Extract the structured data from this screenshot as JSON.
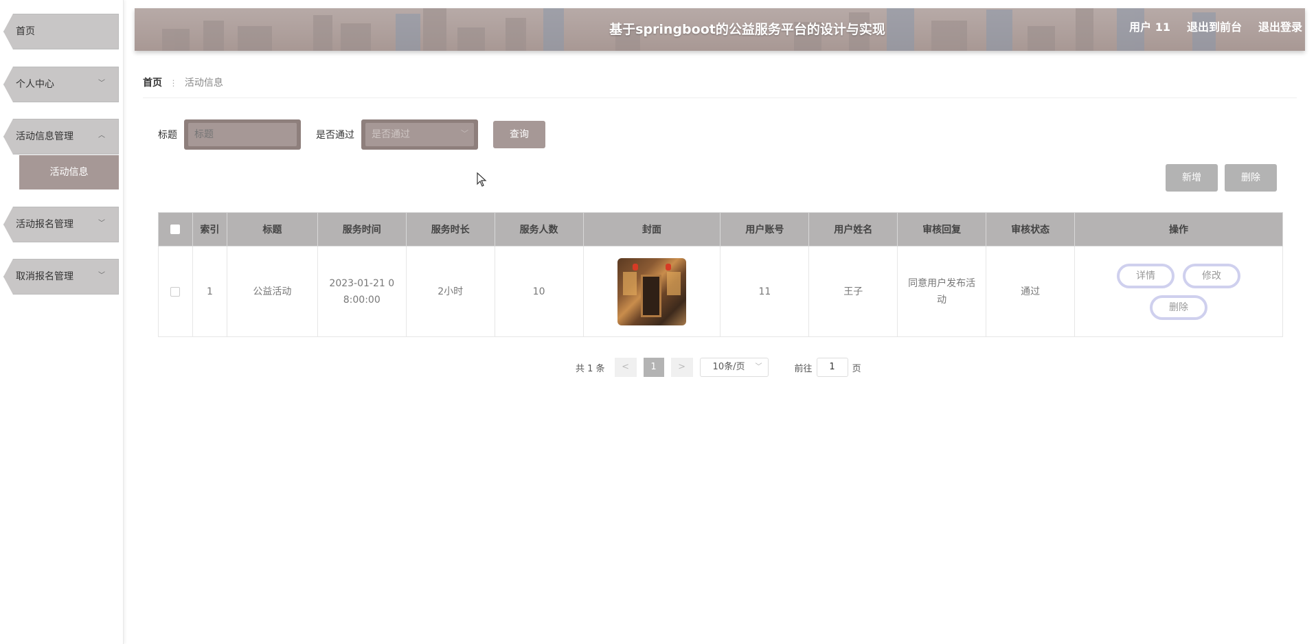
{
  "header": {
    "title": "基于springboot的公益服务平台的设计与实现",
    "user": "用户 11",
    "back_front": "退出到前台",
    "logout": "退出登录"
  },
  "sidebar": {
    "items": [
      {
        "label": "首页",
        "chevron": ""
      },
      {
        "label": "个人中心",
        "chevron": "﹀"
      },
      {
        "label": "活动信息管理",
        "chevron": "︿"
      },
      {
        "label": "活动报名管理",
        "chevron": "﹀"
      },
      {
        "label": "取消报名管理",
        "chevron": "﹀"
      }
    ],
    "sub_item": "活动信息"
  },
  "breadcrumb": {
    "home": "首页",
    "separator": "⋮",
    "current": "活动信息"
  },
  "search": {
    "title_label": "标题",
    "title_placeholder": "标题",
    "pass_label": "是否通过",
    "pass_placeholder": "是否通过",
    "query_label": "查询"
  },
  "actions": {
    "add": "新增",
    "delete": "删除"
  },
  "table": {
    "headers": [
      "索引",
      "标题",
      "服务时间",
      "服务时长",
      "服务人数",
      "封面",
      "用户账号",
      "用户姓名",
      "审核回复",
      "审核状态",
      "操作"
    ],
    "rows": [
      {
        "index": "1",
        "title": "公益活动",
        "service_time": "2023-01-21 08:00:00",
        "duration": "2小时",
        "people": "10",
        "account": "11",
        "name": "王子",
        "reply": "同意用户发布活动",
        "status": "通过",
        "ops": [
          "详情",
          "修改",
          "删除"
        ]
      }
    ]
  },
  "pagination": {
    "total": "共 1 条",
    "prev": "<",
    "page": "1",
    "next": ">",
    "page_size": "10条/页",
    "goto_label": "前往",
    "goto_value": "1",
    "page_suffix": "页"
  },
  "colors": {
    "accent": "#a69896",
    "header_bg": "#b0a3a0",
    "table_header": "#b5b3b3",
    "button_gray": "#b3b3b3"
  }
}
